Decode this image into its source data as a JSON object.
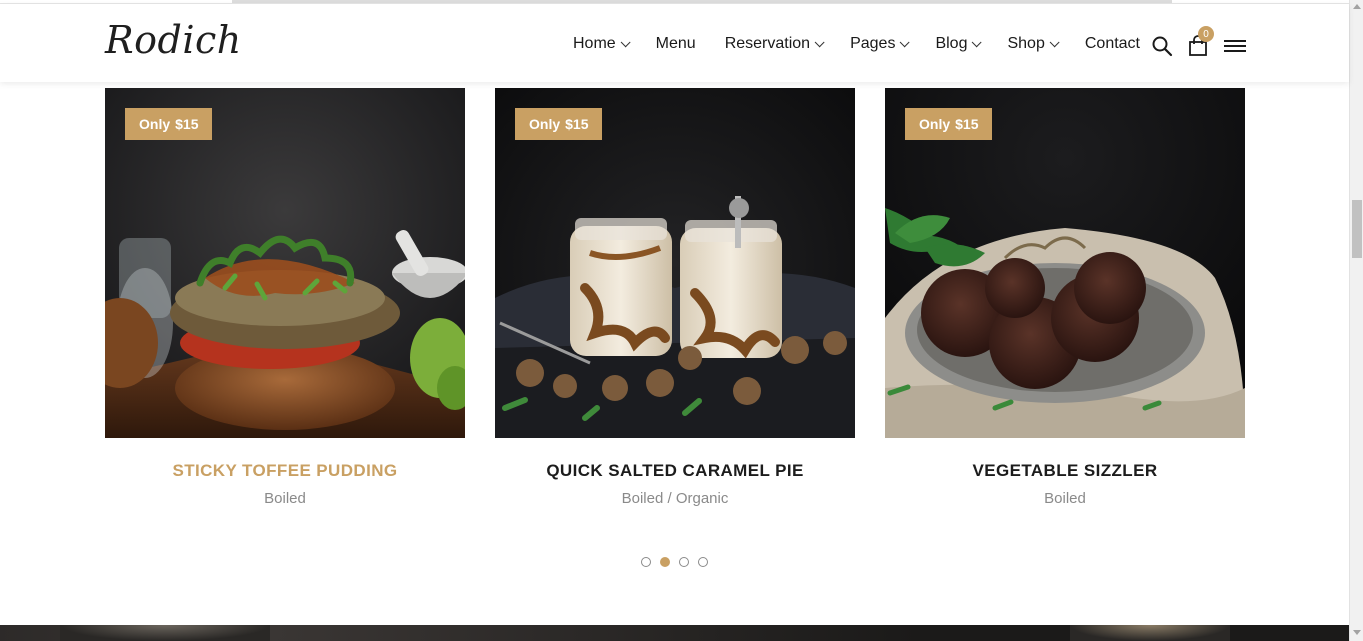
{
  "brand": {
    "logo_text": "Rodich"
  },
  "nav": {
    "items": [
      {
        "label": "Home",
        "has_dropdown": true
      },
      {
        "label": "Menu",
        "has_dropdown": false
      },
      {
        "label": "Reservation",
        "has_dropdown": true
      },
      {
        "label": "Pages",
        "has_dropdown": true
      },
      {
        "label": "Blog",
        "has_dropdown": true
      },
      {
        "label": "Shop",
        "has_dropdown": true
      },
      {
        "label": "Contact",
        "has_dropdown": false
      }
    ],
    "cart_count": "0",
    "icons": [
      "search-icon",
      "shopping-bag-icon",
      "hamburger-menu-icon"
    ]
  },
  "products": [
    {
      "price_prefix": "Only",
      "price": "$15",
      "title": "Sticky Toffee Pudding",
      "category": "Boiled",
      "active": true,
      "image": "burger-photo"
    },
    {
      "price_prefix": "Only",
      "price": "$15",
      "title": "Quick Salted Caramel Pie",
      "category": "Boiled / Organic",
      "active": false,
      "image": "caramel-jars-photo"
    },
    {
      "price_prefix": "Only",
      "price": "$15",
      "title": "Vegetable Sizzler",
      "category": "Boiled",
      "active": false,
      "image": "chocolate-cookies-photo"
    }
  ],
  "carousel": {
    "total_pages": 4,
    "active_index": 1
  },
  "colors": {
    "accent": "#c9a063",
    "text": "#1c1c1c",
    "muted": "#8a8a8a"
  }
}
